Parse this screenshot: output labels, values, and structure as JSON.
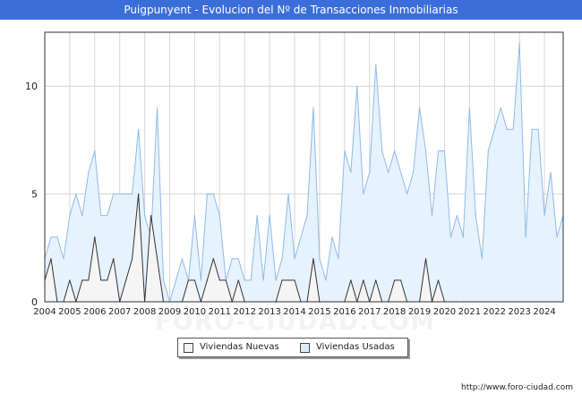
{
  "title": "Puigpunyent - Evolucion del Nº de Transacciones Inmobiliarias",
  "source_url": "http://www.foro-ciudad.com",
  "watermark": "FORO-CIUDAD.COM",
  "colors": {
    "title_bg": "#3c6ed9",
    "nuevas_fill": "#f5f5f5",
    "nuevas_line": "#333333",
    "usadas_fill": "#e6f2fd",
    "usadas_line": "#8fbbe6",
    "usadas_peak_line": "#2f6fcc",
    "grid": "#d6d6d6"
  },
  "legend": [
    {
      "label": "Viviendas Nuevas",
      "swatch": "#f5f5f5"
    },
    {
      "label": "Viviendas Usadas",
      "swatch": "#dceefd"
    }
  ],
  "chart_data": {
    "type": "area",
    "title": "Puigpunyent - Evolucion del Nº de Transacciones Inmobiliarias",
    "xlabel": "",
    "ylabel": "",
    "x_ticks": [
      "2004",
      "2005",
      "2006",
      "2007",
      "2008",
      "2009",
      "2010",
      "2011",
      "2012",
      "2013",
      "2014",
      "2015",
      "2016",
      "2017",
      "2018",
      "2019",
      "2020",
      "2021",
      "2022",
      "2023",
      "2024"
    ],
    "y_ticks": [
      0,
      5,
      10
    ],
    "ylim": [
      0,
      12.5
    ],
    "xlim": [
      2004.0,
      2024.75
    ],
    "grid": true,
    "legend_position": "bottom",
    "series": [
      {
        "name": "Viviendas Usadas",
        "x": [
          2004.0,
          2004.25,
          2004.5,
          2004.75,
          2005.0,
          2005.25,
          2005.5,
          2005.75,
          2006.0,
          2006.25,
          2006.5,
          2006.75,
          2007.0,
          2007.25,
          2007.5,
          2007.75,
          2008.0,
          2008.25,
          2008.5,
          2008.75,
          2009.0,
          2009.25,
          2009.5,
          2009.75,
          2010.0,
          2010.25,
          2010.5,
          2010.75,
          2011.0,
          2011.25,
          2011.5,
          2011.75,
          2012.0,
          2012.25,
          2012.5,
          2012.75,
          2013.0,
          2013.25,
          2013.5,
          2013.75,
          2014.0,
          2014.25,
          2014.5,
          2014.75,
          2015.0,
          2015.25,
          2015.5,
          2015.75,
          2016.0,
          2016.25,
          2016.5,
          2016.75,
          2017.0,
          2017.25,
          2017.5,
          2017.75,
          2018.0,
          2018.25,
          2018.5,
          2018.75,
          2019.0,
          2019.25,
          2019.5,
          2019.75,
          2020.0,
          2020.25,
          2020.5,
          2020.75,
          2021.0,
          2021.25,
          2021.5,
          2021.75,
          2022.0,
          2022.25,
          2022.5,
          2022.75,
          2023.0,
          2023.25,
          2023.5,
          2023.75,
          2024.0,
          2024.25,
          2024.5,
          2024.75
        ],
        "values": [
          2,
          3,
          3,
          2,
          4,
          5,
          4,
          6,
          7,
          4,
          4,
          5,
          5,
          5,
          5,
          8,
          4,
          3,
          9,
          1,
          0,
          1,
          2,
          1,
          4,
          1,
          5,
          5,
          4,
          1,
          2,
          2,
          1,
          1,
          4,
          1,
          4,
          1,
          2,
          5,
          2,
          3,
          4,
          9,
          2,
          1,
          3,
          2,
          7,
          6,
          10,
          5,
          6,
          11,
          7,
          6,
          7,
          6,
          5,
          6,
          9,
          7,
          4,
          7,
          7,
          3,
          4,
          3,
          9,
          4,
          2,
          7,
          8,
          9,
          8,
          8,
          12,
          3,
          8,
          8,
          4,
          6,
          3,
          4
        ]
      },
      {
        "name": "Viviendas Nuevas",
        "x": [
          2004.0,
          2004.25,
          2004.5,
          2004.75,
          2005.0,
          2005.25,
          2005.5,
          2005.75,
          2006.0,
          2006.25,
          2006.5,
          2006.75,
          2007.0,
          2007.25,
          2007.5,
          2007.75,
          2008.0,
          2008.25,
          2008.5,
          2008.75,
          2009.0,
          2009.25,
          2009.5,
          2009.75,
          2010.0,
          2010.25,
          2010.5,
          2010.75,
          2011.0,
          2011.25,
          2011.5,
          2011.75,
          2012.0,
          2012.25,
          2012.5,
          2012.75,
          2013.0,
          2013.25,
          2013.5,
          2013.75,
          2014.0,
          2014.25,
          2014.5,
          2014.75,
          2015.0,
          2015.25,
          2015.5,
          2015.75,
          2016.0,
          2016.25,
          2016.5,
          2016.75,
          2017.0,
          2017.25,
          2017.5,
          2017.75,
          2018.0,
          2018.25,
          2018.5,
          2018.75,
          2019.0,
          2019.25,
          2019.5,
          2019.75,
          2020.0,
          2020.25,
          2020.5,
          2020.75,
          2021.0,
          2021.25,
          2021.5,
          2021.75,
          2022.0,
          2022.25,
          2022.5,
          2022.75,
          2023.0,
          2023.25,
          2023.5,
          2023.75,
          2024.0,
          2024.25,
          2024.5,
          2024.75
        ],
        "values": [
          1,
          2,
          0,
          0,
          1,
          0,
          1,
          1,
          3,
          1,
          1,
          2,
          0,
          1,
          2,
          5,
          0,
          4,
          2,
          0,
          0,
          0,
          0,
          1,
          1,
          0,
          1,
          2,
          1,
          1,
          0,
          1,
          0,
          0,
          0,
          0,
          0,
          0,
          1,
          1,
          1,
          0,
          0,
          2,
          0,
          0,
          0,
          0,
          0,
          1,
          0,
          1,
          0,
          1,
          0,
          0,
          1,
          1,
          0,
          0,
          0,
          2,
          0,
          1,
          0,
          0,
          0,
          0,
          0,
          0,
          0,
          0,
          0,
          0,
          0,
          0,
          0,
          0,
          0,
          0,
          0,
          0,
          0,
          0
        ]
      }
    ]
  }
}
